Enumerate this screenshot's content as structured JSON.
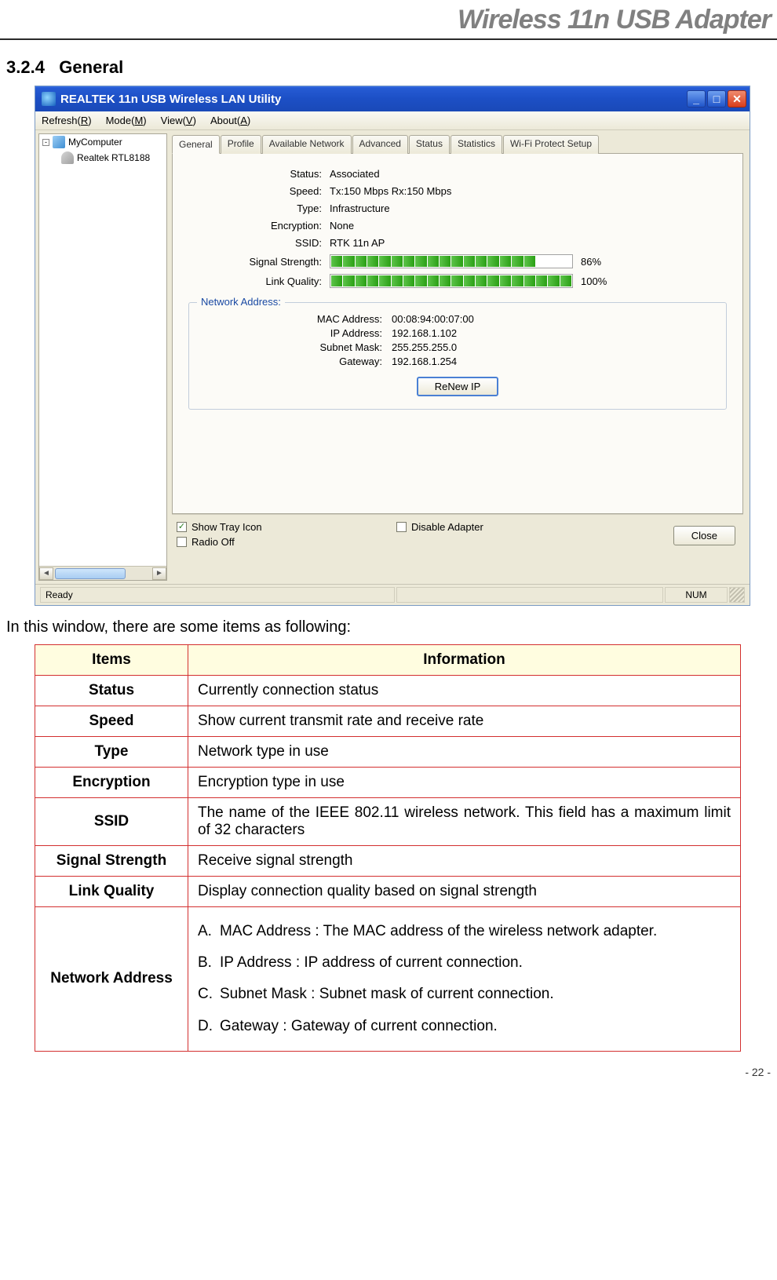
{
  "doc": {
    "header_title": "Wireless 11n USB Adapter",
    "section_number": "3.2.4",
    "section_title": "General",
    "intro": "In this window, there are some items as following:",
    "page_num": "- 22 -"
  },
  "window": {
    "title": "REALTEK 11n USB Wireless LAN Utility",
    "menu": {
      "refresh": "Refresh(R)",
      "mode": "Mode(M)",
      "view": "View(V)",
      "about": "About(A)"
    },
    "tree": {
      "root": "MyComputer",
      "child": "Realtek RTL8188"
    },
    "tabs": [
      "General",
      "Profile",
      "Available Network",
      "Advanced",
      "Status",
      "Statistics",
      "Wi-Fi Protect Setup"
    ],
    "general": {
      "rows": [
        {
          "label": "Status:",
          "value": "Associated"
        },
        {
          "label": "Speed:",
          "value": "Tx:150 Mbps Rx:150 Mbps"
        },
        {
          "label": "Type:",
          "value": "Infrastructure"
        },
        {
          "label": "Encryption:",
          "value": "None"
        },
        {
          "label": "SSID:",
          "value": "RTK 11n AP"
        }
      ],
      "signal_label": "Signal Strength:",
      "signal_pct": "86%",
      "link_label": "Link Quality:",
      "link_pct": "100%",
      "network_address_legend": "Network Address:",
      "net_rows": [
        {
          "label": "MAC Address:",
          "value": "00:08:94:00:07:00"
        },
        {
          "label": "IP Address:",
          "value": "192.168.1.102"
        },
        {
          "label": "Subnet Mask:",
          "value": "255.255.255.0"
        },
        {
          "label": "Gateway:",
          "value": "192.168.1.254"
        }
      ],
      "renew_label": "ReNew IP"
    },
    "bottom": {
      "show_tray": "Show Tray Icon",
      "radio_off": "Radio Off",
      "disable_adapter": "Disable Adapter",
      "close": "Close"
    },
    "statusbar": {
      "ready": "Ready",
      "num": "NUM"
    }
  },
  "table": {
    "head_items": "Items",
    "head_info": "Information",
    "rows": [
      {
        "item": "Status",
        "info": "Currently connection status"
      },
      {
        "item": "Speed",
        "info": "Show current transmit rate and receive rate"
      },
      {
        "item": "Type",
        "info": "Network type in use"
      },
      {
        "item": "Encryption",
        "info": "Encryption type in use"
      },
      {
        "item": "SSID",
        "info": "The name of the IEEE 802.11 wireless network. This field has a maximum limit of 32 characters"
      },
      {
        "item": "Signal Strength",
        "info": "Receive signal strength"
      },
      {
        "item": "Link Quality",
        "info": "Display connection quality based on signal strength"
      }
    ],
    "netaddr": {
      "item": "Network Address",
      "a_letter": "A.",
      "a": "MAC Address : The MAC address of the wireless network adapter.",
      "b_letter": "B.",
      "b": "IP Address : IP address of current connection.",
      "c_letter": "C.",
      "c": "Subnet Mask : Subnet mask of current connection.",
      "d_letter": "D.",
      "d": "Gateway : Gateway of current connection."
    }
  }
}
